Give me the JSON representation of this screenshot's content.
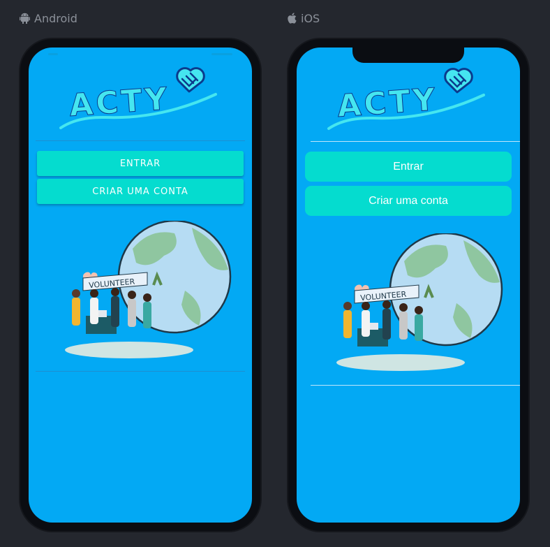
{
  "platforms": {
    "android": {
      "label": "Android",
      "icon": "android-icon",
      "logo_text": "ACTY",
      "buttons": {
        "login": "ENTRAR",
        "signup": "CRIAR UMA CONTA"
      },
      "banner_text": "VOLUNTEER"
    },
    "ios": {
      "label": "iOS",
      "icon": "apple-icon",
      "logo_text": "ACTY",
      "buttons": {
        "login": "Entrar",
        "signup": "Criar uma conta"
      },
      "banner_text": "VOLUNTEER"
    }
  },
  "colors": {
    "background": "#24272e",
    "screen": "#03a9f4",
    "button": "#05dccf",
    "logo": "#45e6f0",
    "logo_outline": "#0b3a8c"
  }
}
